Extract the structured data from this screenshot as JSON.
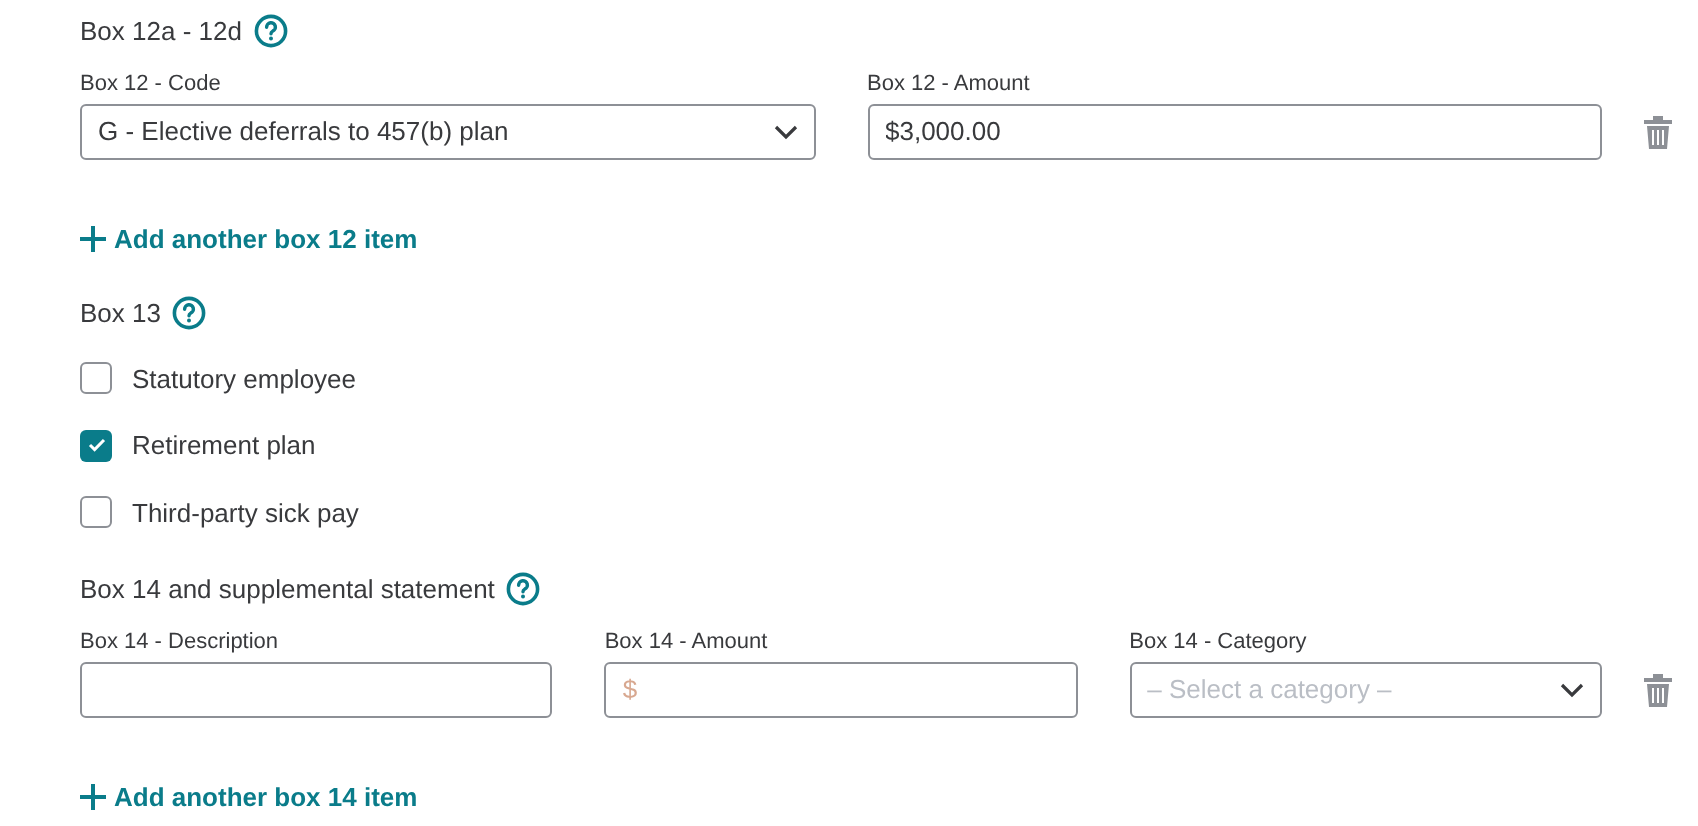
{
  "box12": {
    "heading": "Box 12a - 12d",
    "code": {
      "label": "Box 12 - Code",
      "value": "G - Elective deferrals to 457(b) plan"
    },
    "amount": {
      "label": "Box 12 - Amount",
      "value": "$3,000.00"
    },
    "add_link": "Add another box 12 item"
  },
  "box13": {
    "heading": "Box 13",
    "options": [
      {
        "label": "Statutory employee",
        "checked": false
      },
      {
        "label": "Retirement plan",
        "checked": true
      },
      {
        "label": "Third-party sick pay",
        "checked": false
      }
    ]
  },
  "box14": {
    "heading": "Box 14 and supplemental statement",
    "description": {
      "label": "Box 14 - Description"
    },
    "amount": {
      "label": "Box 14 - Amount",
      "placeholder": "$"
    },
    "category": {
      "label": "Box 14 - Category",
      "placeholder": "– Select a category –"
    },
    "add_link": "Add another box 14 item"
  }
}
